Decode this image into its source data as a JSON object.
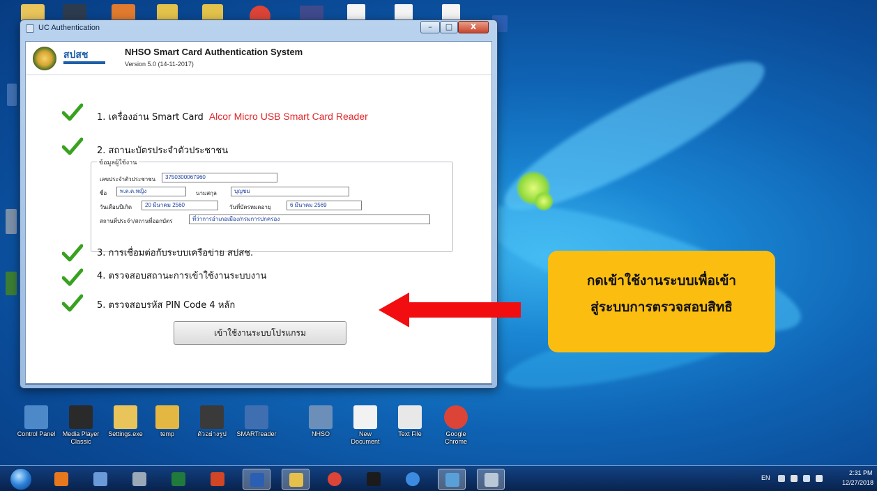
{
  "window": {
    "title": "UC Authentication",
    "controls": {
      "minimize": "–",
      "maximize": "□",
      "close": "X"
    }
  },
  "header": {
    "logo_text": "สปสช",
    "app_title": "NHSO Smart Card  Authentication System",
    "version": "Version 5.0 (14-11-2017)"
  },
  "steps": {
    "s1": {
      "label": "1. เครื่องอ่าน Smart Card",
      "value": "Alcor Micro USB Smart Card Reader"
    },
    "s2": {
      "label": "2. สถานะบัตรประจำตัวประชาชน"
    },
    "s3": {
      "label": "3. การเชื่อมต่อกับระบบเครือข่าย สปสช."
    },
    "s4": {
      "label": "4. ตรวจสอบสถานะการเข้าใช้งานระบบงาน"
    },
    "s5": {
      "label": "5. ตรวจสอบรหัส PIN Code 4 หลัก"
    }
  },
  "user_info": {
    "group_title": "ข้อมูลผู้ใช้งาน",
    "id_label": "เลขประจำตัวประชาชน",
    "id_value": "3750300067960",
    "name_label": "ชื่อ",
    "name_value": "พ.ต.ต.หญิง",
    "surname_label": "นามสกุล",
    "surname_value": "บุญชม",
    "birth_label": "วันเดือนปีเกิด",
    "birth_value": "20 มีนาคม 2560",
    "expiry_label": "วันที่บัตรหมดอายุ",
    "expiry_value": "6 มีนาคม 2569",
    "place_label": "สถานที่ประจำ/สถานที่ออกบัตร",
    "place_value": "ที่ว่าการอำเภอเมือง/กรมการปกครอง"
  },
  "main_button": {
    "label": "เข้าใช้งานระบบโปรแกรม"
  },
  "annotation": {
    "line1": "กดเข้าใช้งานระบบเพื่อเข้า",
    "line2": "สู่ระบบการตรวจสอบสิทธิ",
    "box_color": "#fbbe10",
    "arrow_color": "#f10d10"
  },
  "desktop_icons": [
    {
      "name": "Control Panel",
      "icon": "control-panel-icon",
      "color": "#4d88c9"
    },
    {
      "name": "Media Player Classic",
      "icon": "media-player-icon",
      "color": "#2a2a2a"
    },
    {
      "name": "Settings.exe",
      "icon": "folder-icon",
      "color": "#e8c45b"
    },
    {
      "name": "temp",
      "icon": "folder-icon",
      "color": "#e3b741"
    },
    {
      "name": "ตัวอย่างรูป",
      "icon": "presentation-icon",
      "color": "#3a3a3a"
    },
    {
      "name": "SMARTreader",
      "icon": "program-icon",
      "color": "#3f6fb0"
    },
    {
      "name": "NHSO",
      "icon": "network-icon",
      "color": "#6b8fb8"
    },
    {
      "name": "New Document",
      "icon": "document-icon",
      "color": "#f2f2f2"
    },
    {
      "name": "Text File",
      "icon": "document-icon",
      "color": "#e8e8e8"
    },
    {
      "name": "Google Chrome",
      "icon": "chrome-icon",
      "color": "#db4437"
    }
  ],
  "taskbar": {
    "tray_lang": "EN",
    "time": "2:31 PM",
    "date": "12/27/2018"
  }
}
